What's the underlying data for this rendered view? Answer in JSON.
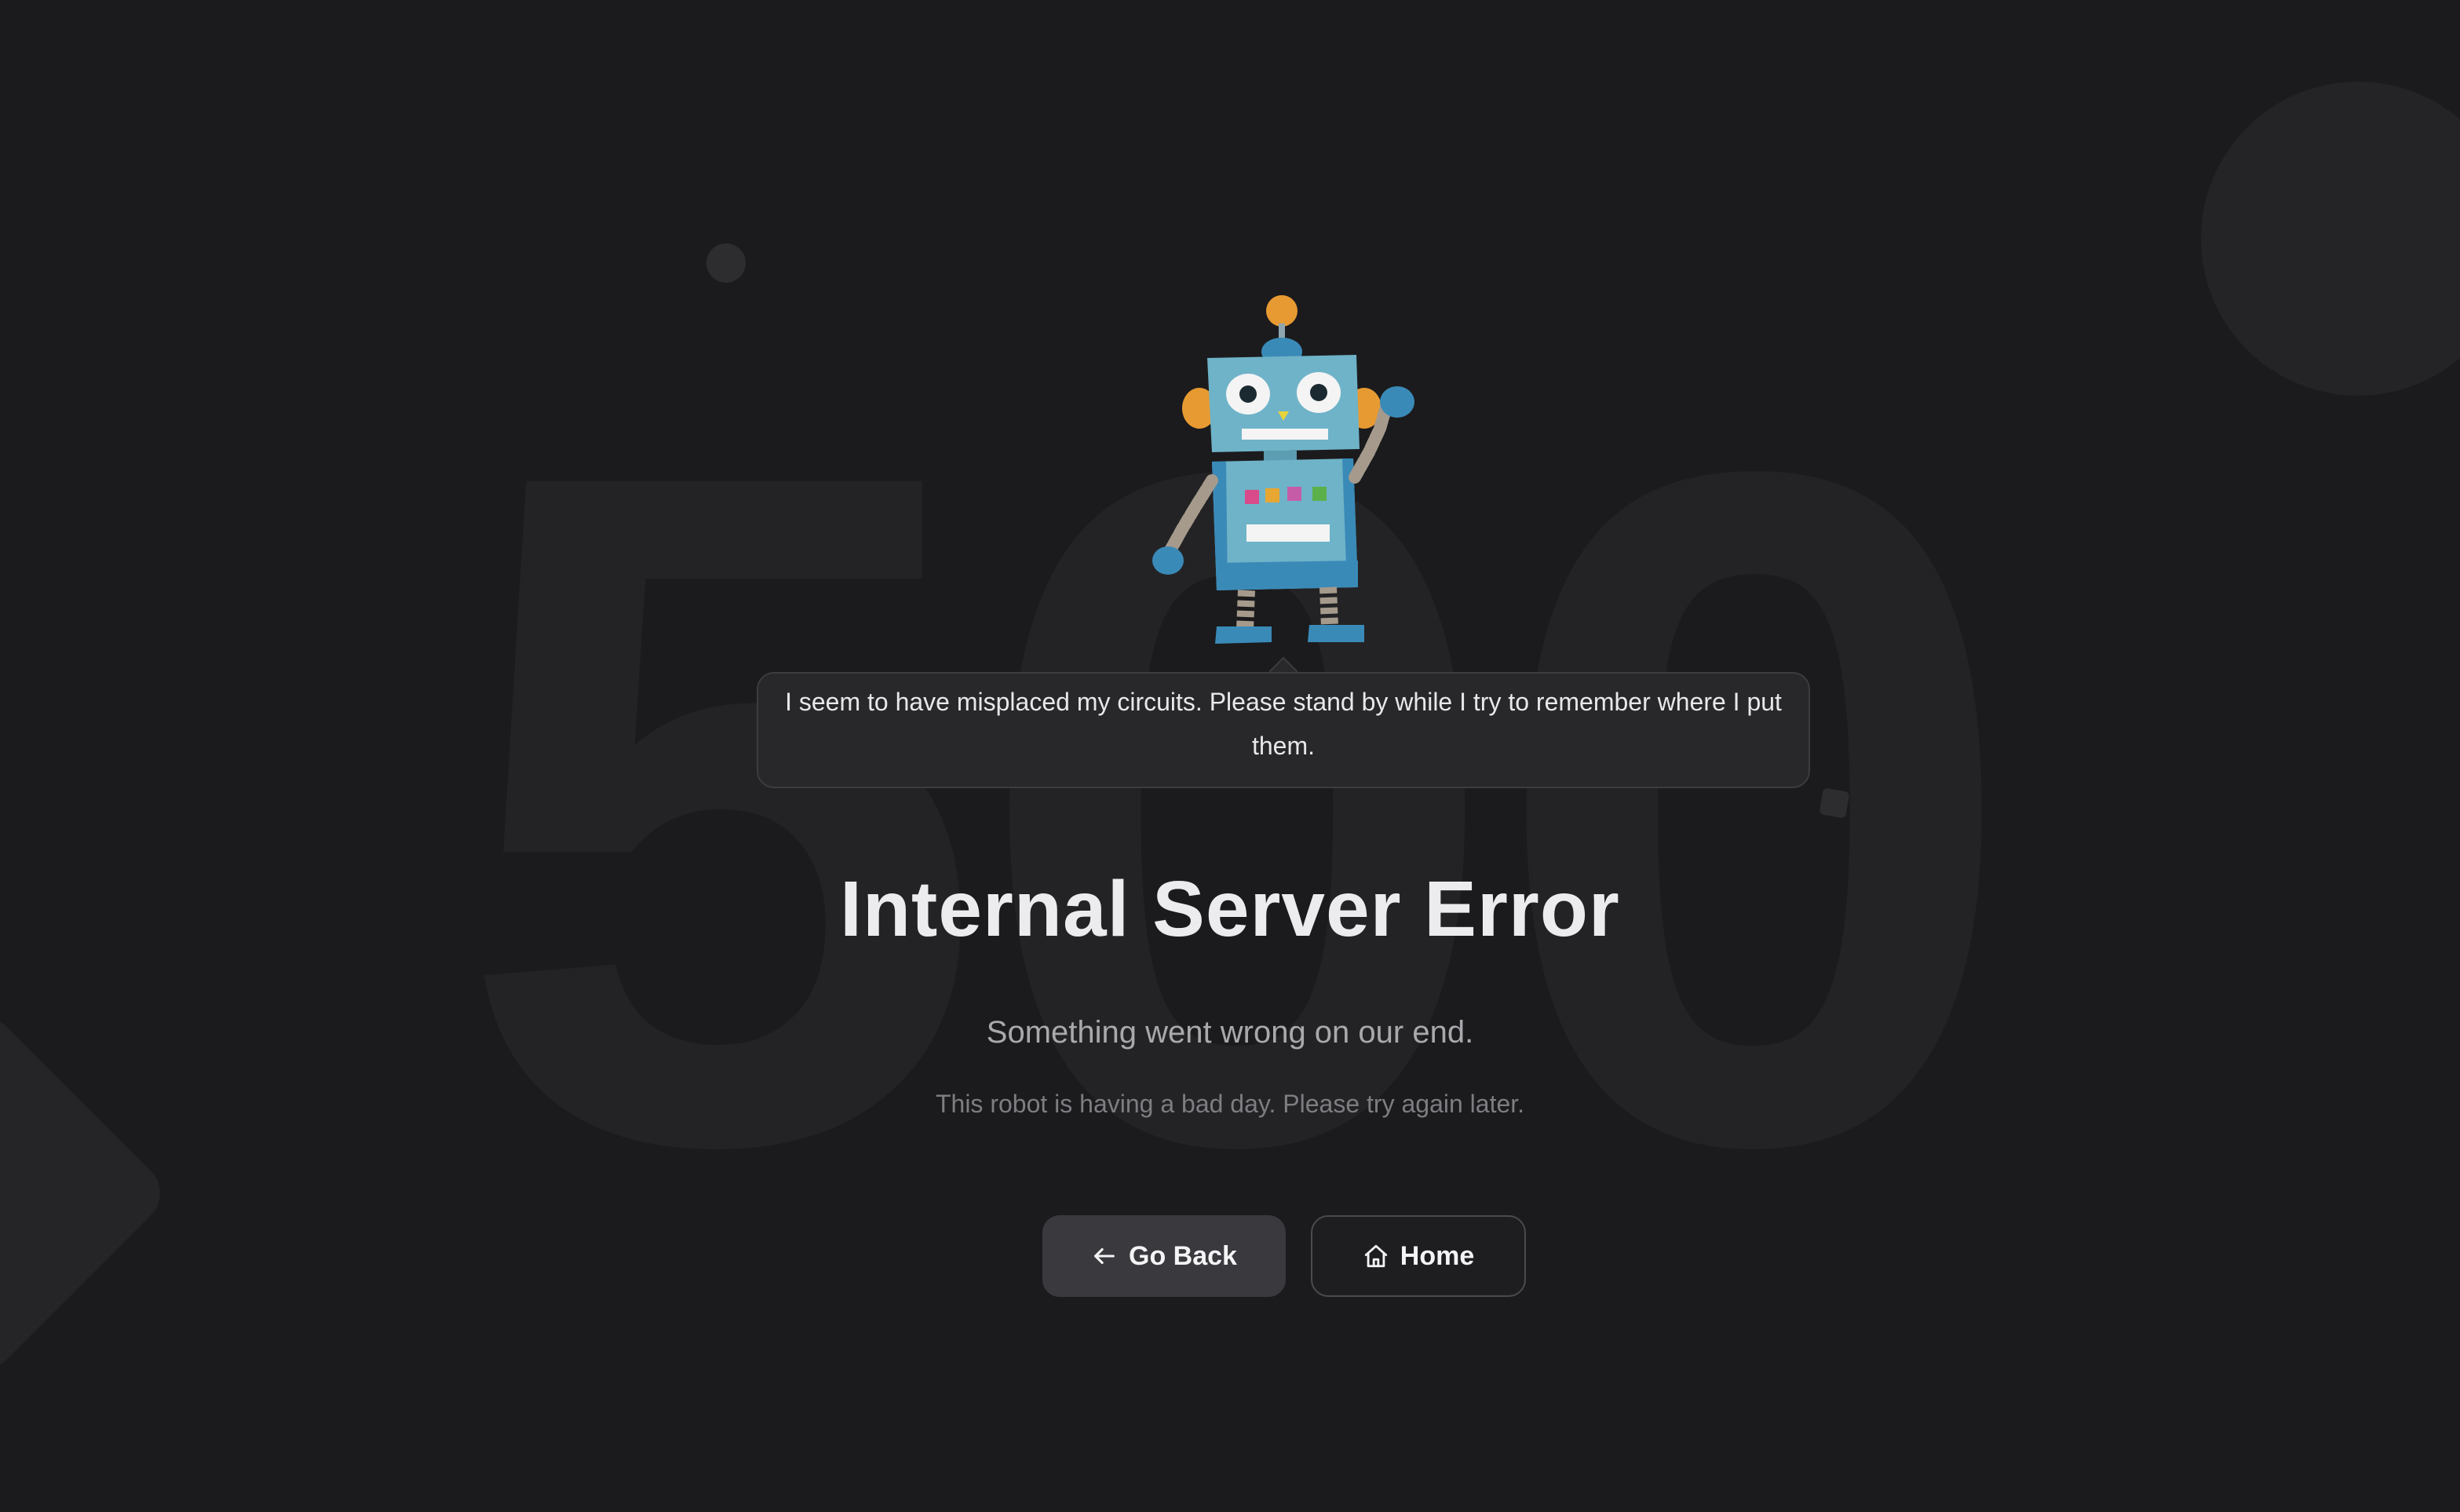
{
  "background": {
    "code": "500",
    "color": "#1b1b1d"
  },
  "robot": {
    "icon": "robot-illustration",
    "colors": {
      "body": "#6fb3c8",
      "accent_blue": "#3a8ab8",
      "orange": "#e89a32",
      "limbs": "#a59a8c"
    }
  },
  "bubble": {
    "message": "I seem to have misplaced my circuits. Please stand by while I try to remember where I put them."
  },
  "error": {
    "title": "Internal Server Error",
    "subtitle": "Something went wrong on our end.",
    "detail": "This robot is having a bad day. Please try again later."
  },
  "actions": {
    "back": {
      "label": "Go Back",
      "icon": "arrow-left-icon"
    },
    "home": {
      "label": "Home",
      "icon": "home-icon"
    }
  }
}
